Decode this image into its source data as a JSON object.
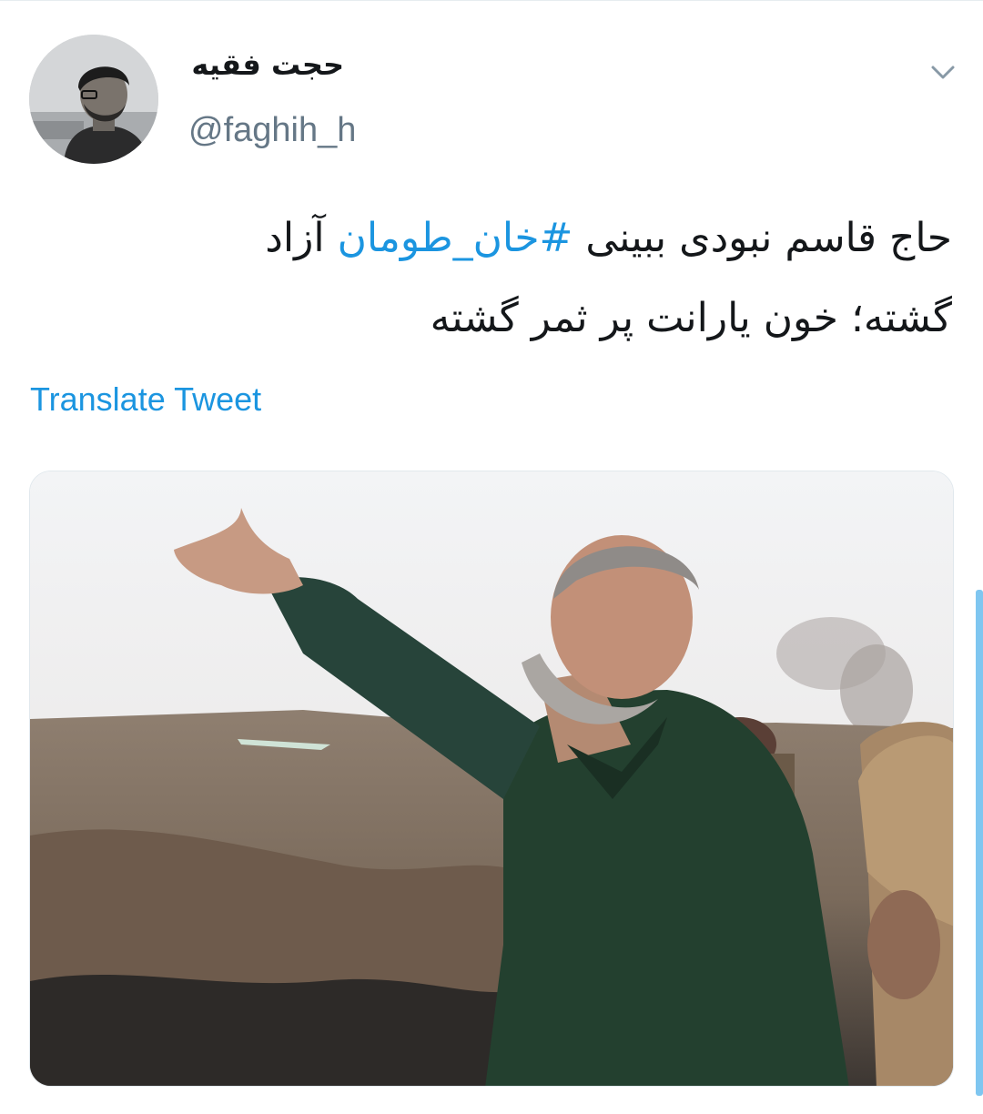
{
  "header": {
    "display_name": "حجت فقیه",
    "handle": "@faghih_h",
    "avatar_icon": "user-photo",
    "menu_icon": "chevron-down-icon"
  },
  "tweet": {
    "text_line1_before": "حاج قاسم نبودی ببینی ",
    "hashtag": "#خان_طومان",
    "text_line1_after": " آزاد",
    "text_line2": "گشته؛ خون یارانت پر ثمر گشته",
    "translate_label": "Translate Tweet"
  },
  "media": {
    "description_icon": "photo"
  },
  "colors": {
    "link": "#1b95e0",
    "secondary_text": "#657786",
    "primary_text": "#14171a",
    "border": "#e1e8ed"
  }
}
